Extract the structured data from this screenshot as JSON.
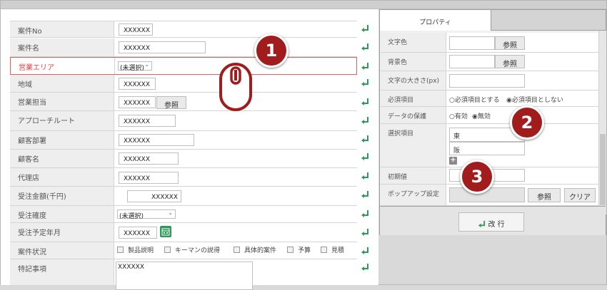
{
  "form": {
    "rows": [
      {
        "label": "案件No",
        "value": "XXXXXX"
      },
      {
        "label": "案件名",
        "value": "XXXXXX"
      },
      {
        "label": "営業エリア",
        "value": "(未選択)"
      },
      {
        "label": "地域",
        "value": "XXXXXX"
      },
      {
        "label": "営業担当",
        "value": "XXXXXX",
        "button": "参照"
      },
      {
        "label": "アプローチルート",
        "value": "XXXXXX"
      },
      {
        "label": "顧客部署",
        "value": "XXXXXX"
      },
      {
        "label": "顧客名",
        "value": "XXXXXX"
      },
      {
        "label": "代理店",
        "value": "XXXXXX"
      },
      {
        "label": "受注金額(千円)",
        "value": "XXXXXX"
      },
      {
        "label": "受注確度",
        "value": "(未選択)"
      },
      {
        "label": "受注予定年月",
        "value": "XXXXXX"
      },
      {
        "label": "案件状況",
        "checkboxes": [
          "製品説明",
          "キーマンの説得",
          "具体的案件",
          "予算",
          "見積"
        ]
      },
      {
        "label": "特記事項",
        "value": "XXXXXX"
      }
    ]
  },
  "panel": {
    "tab_label": "プロパティ",
    "rows": {
      "text_color": {
        "label": "文字色",
        "button": "参照"
      },
      "bg_color": {
        "label": "背景色",
        "button": "参照"
      },
      "font_size": {
        "label": "文字の大きさ(px)"
      },
      "required": {
        "label": "必須項目",
        "opt1": "○必須項目とする",
        "opt2": "◉必須項目としない"
      },
      "protect": {
        "label": "データの保護",
        "opt1": "○有効",
        "opt2": "◉無効"
      },
      "choices": {
        "label": "選択項目",
        "items": [
          "東",
          "阪"
        ]
      },
      "initial": {
        "label": "初期値"
      },
      "popup": {
        "label": "ポップアップ設定",
        "button1": "参照",
        "button2": "クリア"
      }
    },
    "linebreak_button": "改 行"
  },
  "badges": [
    "1",
    "2",
    "3"
  ],
  "icons": {
    "enter": "enter-arrow-icon",
    "calendar": "calendar-icon",
    "mouse": "mouse-icon",
    "add": "plus-icon"
  },
  "colors": {
    "accent_green": "#2e9a5a",
    "badge": "#a11c1c",
    "selected_border": "#e06060"
  }
}
